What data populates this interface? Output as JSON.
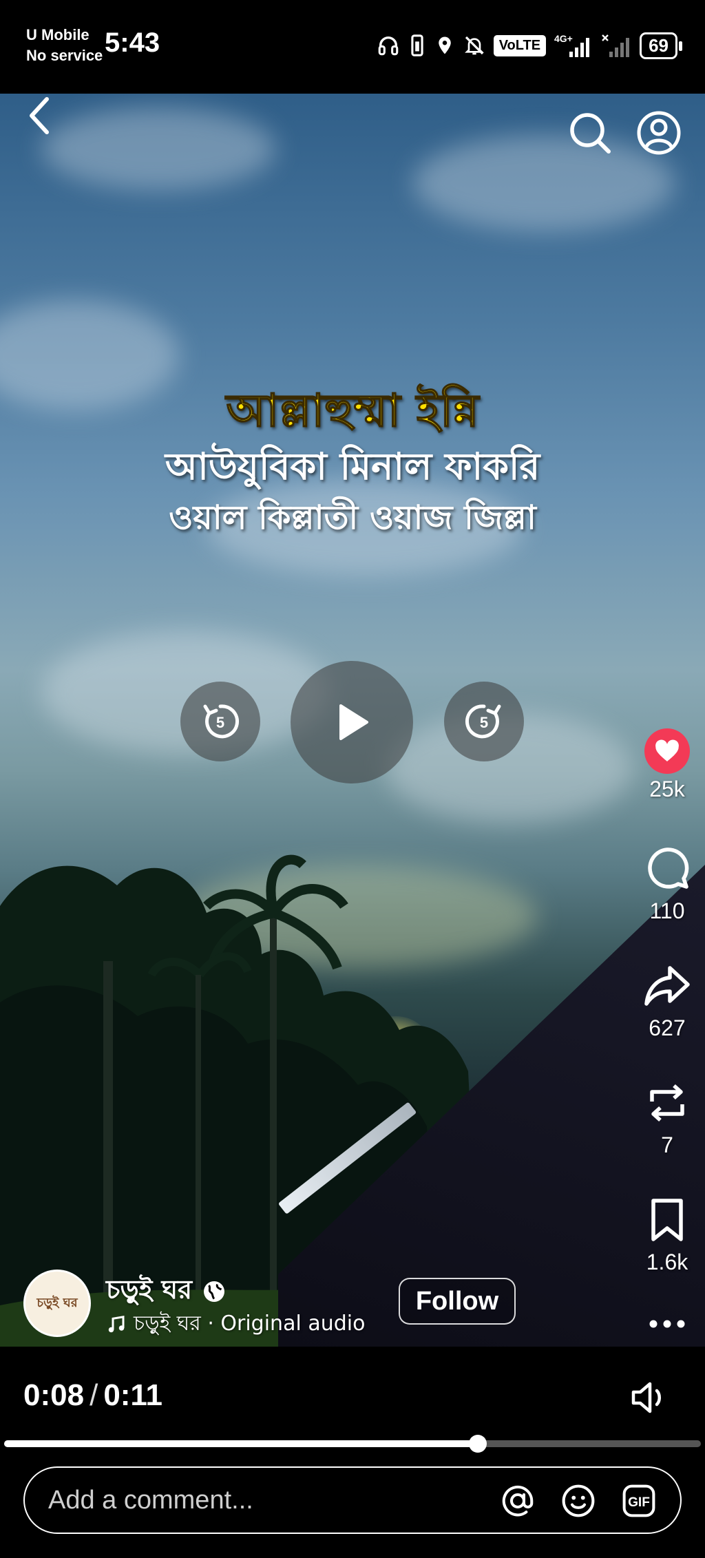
{
  "status_bar": {
    "carrier": "U Mobile",
    "service": "No service",
    "time": "5:43",
    "volte": "VoLTE",
    "network": "4G+",
    "battery": "69"
  },
  "top_bar": {
    "back_icon": "chevron-left-icon",
    "search_icon": "search-icon",
    "profile_icon": "profile-icon"
  },
  "video": {
    "overlay_line1": "আল্লাহুম্মা ইন্নি",
    "overlay_line2": "আউযুবিকা মিনাল ফাকরি",
    "overlay_line3": "ওয়াল কিল্লাতী ওয়াজ জিল্লা",
    "rewind_seconds": "5",
    "forward_seconds": "5"
  },
  "actions": {
    "likes": "25k",
    "comments": "110",
    "shares": "627",
    "reposts": "7",
    "saves": "1.6k",
    "like_color": "#f33a56"
  },
  "author": {
    "avatar_text": "চড়ুই ঘর",
    "name": "চড়ুই ঘর",
    "audio": "চড়ুই ঘর · Original audio",
    "follow_label": "Follow"
  },
  "player": {
    "current_time": "0:08",
    "separator": "/",
    "duration": "0:11",
    "progress": 0.68
  },
  "comment": {
    "placeholder": "Add a comment...",
    "gif_label": "GIF"
  }
}
